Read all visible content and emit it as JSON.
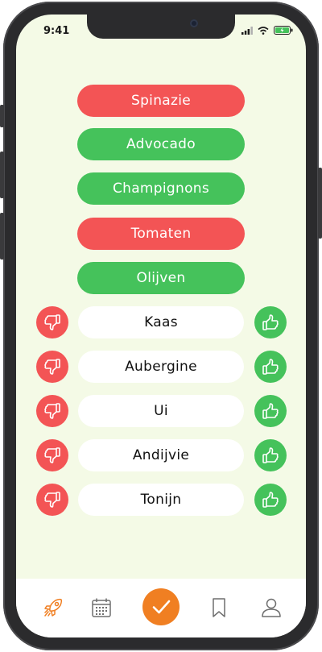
{
  "status": {
    "time": "9:41"
  },
  "colors": {
    "disliked": "#f35455",
    "liked": "#45c25b",
    "accent": "#f07f22",
    "background": "#f4fae6"
  },
  "rated_items": [
    {
      "label": "Spinazie",
      "status": "disliked"
    },
    {
      "label": "Advocado",
      "status": "liked"
    },
    {
      "label": "Champignons",
      "status": "liked"
    },
    {
      "label": "Tomaten",
      "status": "disliked"
    },
    {
      "label": "Olijven",
      "status": "liked"
    }
  ],
  "unrated_items": [
    {
      "label": "Kaas"
    },
    {
      "label": "Aubergine"
    },
    {
      "label": "Ui"
    },
    {
      "label": "Andijvie"
    },
    {
      "label": "Tonijn"
    }
  ],
  "tabbar": {
    "tabs": [
      {
        "icon": "rocket-icon"
      },
      {
        "icon": "calendar-icon"
      },
      {
        "icon": "checkmark-icon",
        "active": true
      },
      {
        "icon": "bookmark-icon"
      },
      {
        "icon": "profile-icon"
      }
    ]
  }
}
